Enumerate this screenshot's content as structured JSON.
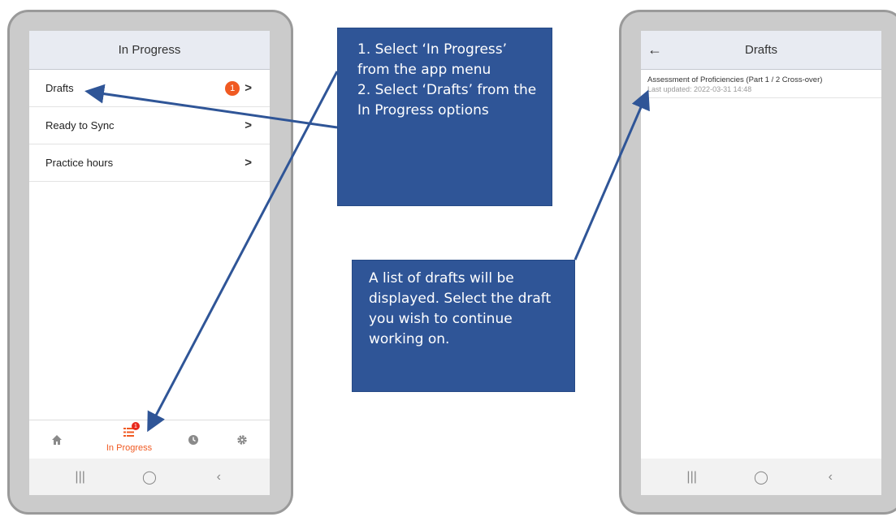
{
  "left_screen": {
    "title": "In Progress",
    "rows": [
      {
        "label": "Drafts",
        "badge": "1"
      },
      {
        "label": "Ready to Sync"
      },
      {
        "label": "Practice hours"
      }
    ],
    "tabbar": {
      "tabs": [
        "home-icon",
        "in-progress-icon",
        "clock-icon",
        "gear-icon"
      ],
      "active_label": "In Progress",
      "active_badge": "1",
      "active_color": "#f05a22"
    }
  },
  "right_screen": {
    "title": "Drafts",
    "drafts": [
      {
        "title": "Assessment of Proficiencies (Part 1 / 2 Cross-over)",
        "updated": "Last updated: 2022-03-31 14:48"
      }
    ]
  },
  "system_nav": {
    "recents": "|||",
    "home": "◯",
    "back": "‹"
  },
  "callouts": {
    "first": "1. Select ‘In Progress’ from the app menu\n2. Select ‘Drafts’ from the In Progress options",
    "second": "A list of drafts will be displayed. Select the draft you wish to continue working on."
  },
  "colors": {
    "callout_bg": "#2f5597",
    "badge": "#f05a22",
    "appbar_bg": "#e8ebf2"
  }
}
